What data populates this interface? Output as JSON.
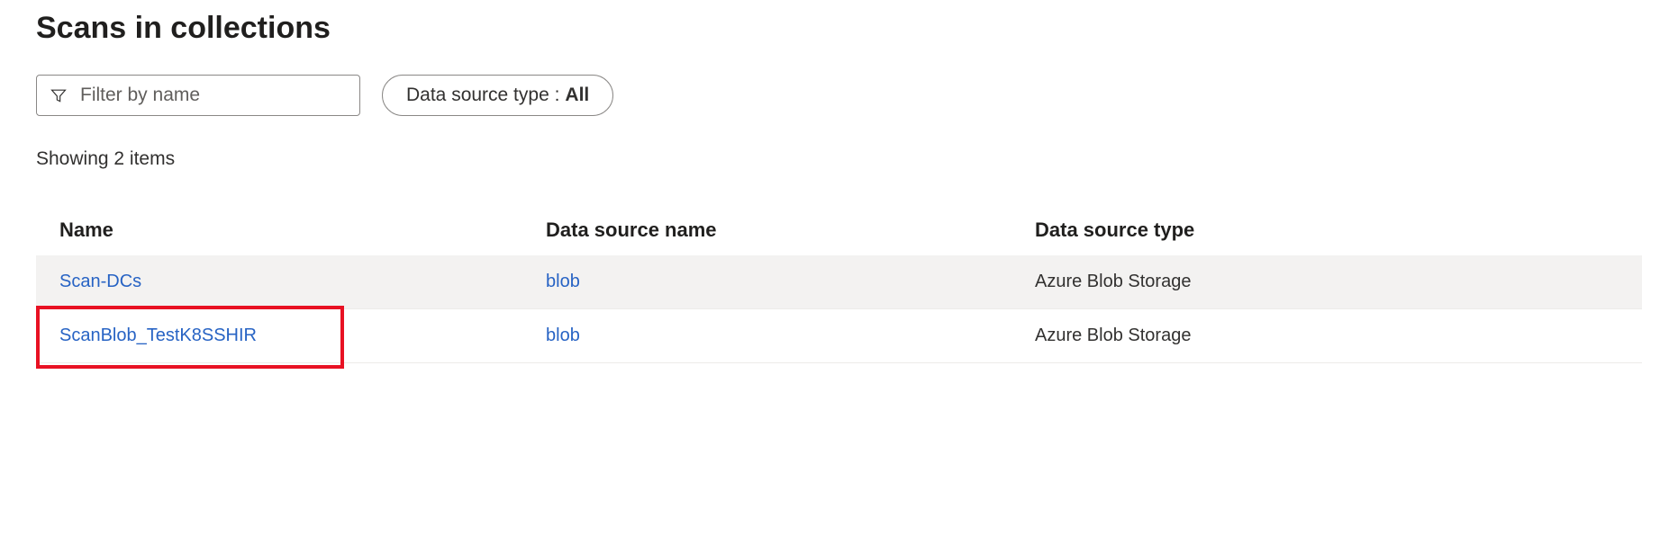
{
  "page": {
    "title": "Scans in collections",
    "showing_label": "Showing 2 items"
  },
  "filters": {
    "name_placeholder": "Filter by name",
    "datasource_pill_label": "Data source type :",
    "datasource_pill_value": "All"
  },
  "table": {
    "columns": {
      "name": "Name",
      "data_source_name": "Data source name",
      "data_source_type": "Data source type"
    },
    "rows": [
      {
        "name": "Scan-DCs",
        "data_source_name": "blob",
        "data_source_type": "Azure Blob Storage"
      },
      {
        "name": "ScanBlob_TestK8SSHIR",
        "data_source_name": "blob",
        "data_source_type": "Azure Blob Storage"
      }
    ]
  },
  "annotation": {
    "highlight_row_index": 1
  }
}
